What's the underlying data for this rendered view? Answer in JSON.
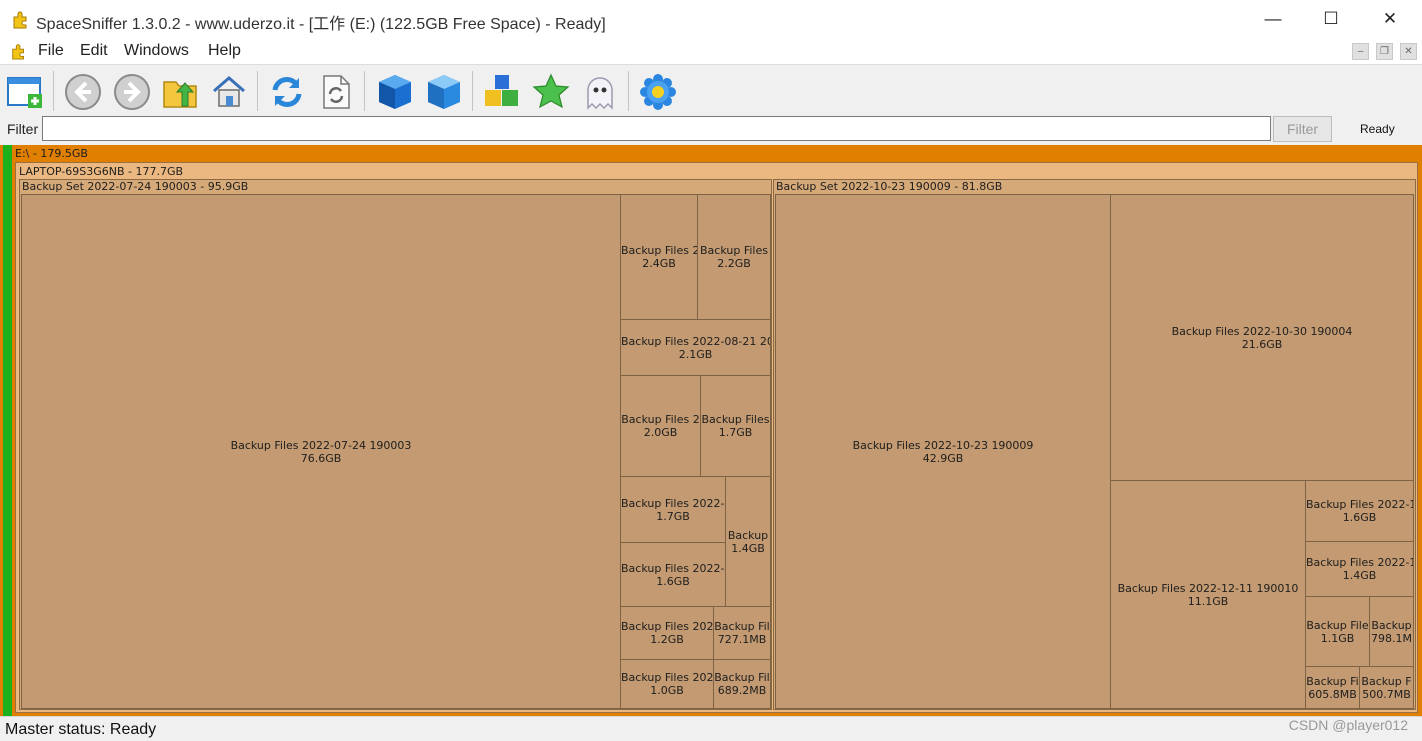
{
  "window": {
    "title": "SpaceSniffer 1.3.0.2 - www.uderzo.it - [工作 (E:) (122.5GB Free Space) - Ready]",
    "minimize": "—",
    "maximize": "☐",
    "close": "✕"
  },
  "menu": {
    "items": [
      "File",
      "Edit",
      "Windows",
      "Help"
    ]
  },
  "toolbar": {
    "buttons": [
      "new-window",
      "back",
      "forward",
      "open-folder",
      "home",
      "refresh",
      "refresh-file",
      "blue-cube",
      "blue-cube-outline",
      "tags",
      "favorite",
      "ghost",
      "settings"
    ]
  },
  "filter": {
    "label": "Filter",
    "value": "",
    "button": "Filter",
    "status": "Ready"
  },
  "treemap": {
    "root": "E:\\ - 179.5GB",
    "computer": "LAPTOP-69S3G6NB - 177.7GB",
    "set1": {
      "header": "Backup Set 2022-07-24 190003 - 95.9GB",
      "big": [
        "Backup Files 2022-07-24 190003",
        "76.6GB"
      ],
      "c1": [
        "Backup Files 2",
        "2.4GB"
      ],
      "c2": [
        "Backup Files",
        "2.2GB"
      ],
      "c3": [
        "Backup Files 2022-08-21 201",
        "2.1GB"
      ],
      "c4": [
        "Backup Files 2",
        "2.0GB"
      ],
      "c5": [
        "Backup Files",
        "1.7GB"
      ],
      "c6": [
        "Backup Files 2022-1",
        "1.7GB"
      ],
      "c7": [
        "Backup Files 2022-0",
        "1.6GB"
      ],
      "c8": [
        "Backup",
        "1.4GB"
      ],
      "c9": [
        "Backup Files 202",
        "1.2GB"
      ],
      "c10": [
        "Backup Fil",
        "727.1MB"
      ],
      "c11": [
        "Backup Files 202",
        "1.0GB"
      ],
      "c12": [
        "Backup Fil",
        "689.2MB"
      ]
    },
    "set2": {
      "header": "Backup Set 2022-10-23 190009 - 81.8GB",
      "big": [
        "Backup Files 2022-10-23 190009",
        "42.9GB"
      ],
      "d1": [
        "Backup Files 2022-10-30 190004",
        "21.6GB"
      ],
      "d2": [
        "Backup Files 2022-12-11 190010",
        "11.1GB"
      ],
      "d3": [
        "Backup Files 2022-1",
        "1.6GB"
      ],
      "d4": [
        "Backup Files 2022-1",
        "1.4GB"
      ],
      "d5": [
        "Backup File",
        "1.1GB"
      ],
      "d6": [
        "Backup",
        "798.1M"
      ],
      "d7": [
        "Backup Fi",
        "605.8MB"
      ],
      "d8": [
        "Backup F",
        "500.7MB"
      ]
    }
  },
  "status": {
    "master": "Master status: Ready",
    "watermark": "CSDN @player012"
  },
  "colors": {
    "root_bg": "#e07f00",
    "computer_bg": "#eab880",
    "set_bg": "#d6a979",
    "leaf": "#c39a71",
    "green": "#1cb01c"
  }
}
